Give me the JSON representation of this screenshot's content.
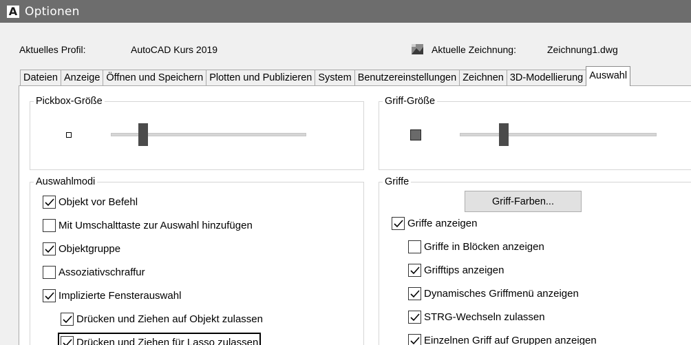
{
  "window": {
    "title": "Optionen",
    "logo_letter": "A"
  },
  "profile": {
    "label": "Aktuelles Profil:",
    "value": "AutoCAD Kurs 2019",
    "drawing_label": "Aktuelle Zeichnung:",
    "drawing_value": "Zeichnung1.dwg"
  },
  "tabs": [
    {
      "label": "Dateien",
      "active": false
    },
    {
      "label": "Anzeige",
      "active": false
    },
    {
      "label": "Öffnen und Speichern",
      "active": false
    },
    {
      "label": "Plotten und Publizieren",
      "active": false
    },
    {
      "label": "System",
      "active": false
    },
    {
      "label": "Benutzereinstellungen",
      "active": false
    },
    {
      "label": "Zeichnen",
      "active": false
    },
    {
      "label": "3D-Modellierung",
      "active": false
    },
    {
      "label": "Auswahl",
      "active": true
    }
  ],
  "pickbox": {
    "title": "Pickbox-Größe"
  },
  "grip_size": {
    "title": "Griff-Größe"
  },
  "selection_modes": {
    "title": "Auswahlmodi",
    "items": [
      {
        "label": "Objekt vor Befehl",
        "checked": true
      },
      {
        "label": "Mit Umschalttaste zur Auswahl hinzufügen",
        "checked": false
      },
      {
        "label": "Objektgruppe",
        "checked": true
      },
      {
        "label": "Assoziativschraffur",
        "checked": false
      },
      {
        "label": "Implizierte Fensterauswahl",
        "checked": true
      },
      {
        "label": "Drücken und Ziehen auf Objekt zulassen",
        "checked": true
      },
      {
        "label": "Drücken und Ziehen für Lasso zulassen",
        "checked": true
      }
    ]
  },
  "grips": {
    "title": "Griffe",
    "color_button": "Griff-Farben...",
    "items": [
      {
        "label": "Griffe anzeigen",
        "checked": true
      },
      {
        "label": "Griffe in Blöcken anzeigen",
        "checked": false
      },
      {
        "label": "Grifftips anzeigen",
        "checked": true
      },
      {
        "label": "Dynamisches Griffmenü anzeigen",
        "checked": true
      },
      {
        "label": "STRG-Wechseln zulassen",
        "checked": true
      },
      {
        "label": "Einzelnen Griff auf Gruppen anzeigen",
        "checked": true
      }
    ]
  }
}
